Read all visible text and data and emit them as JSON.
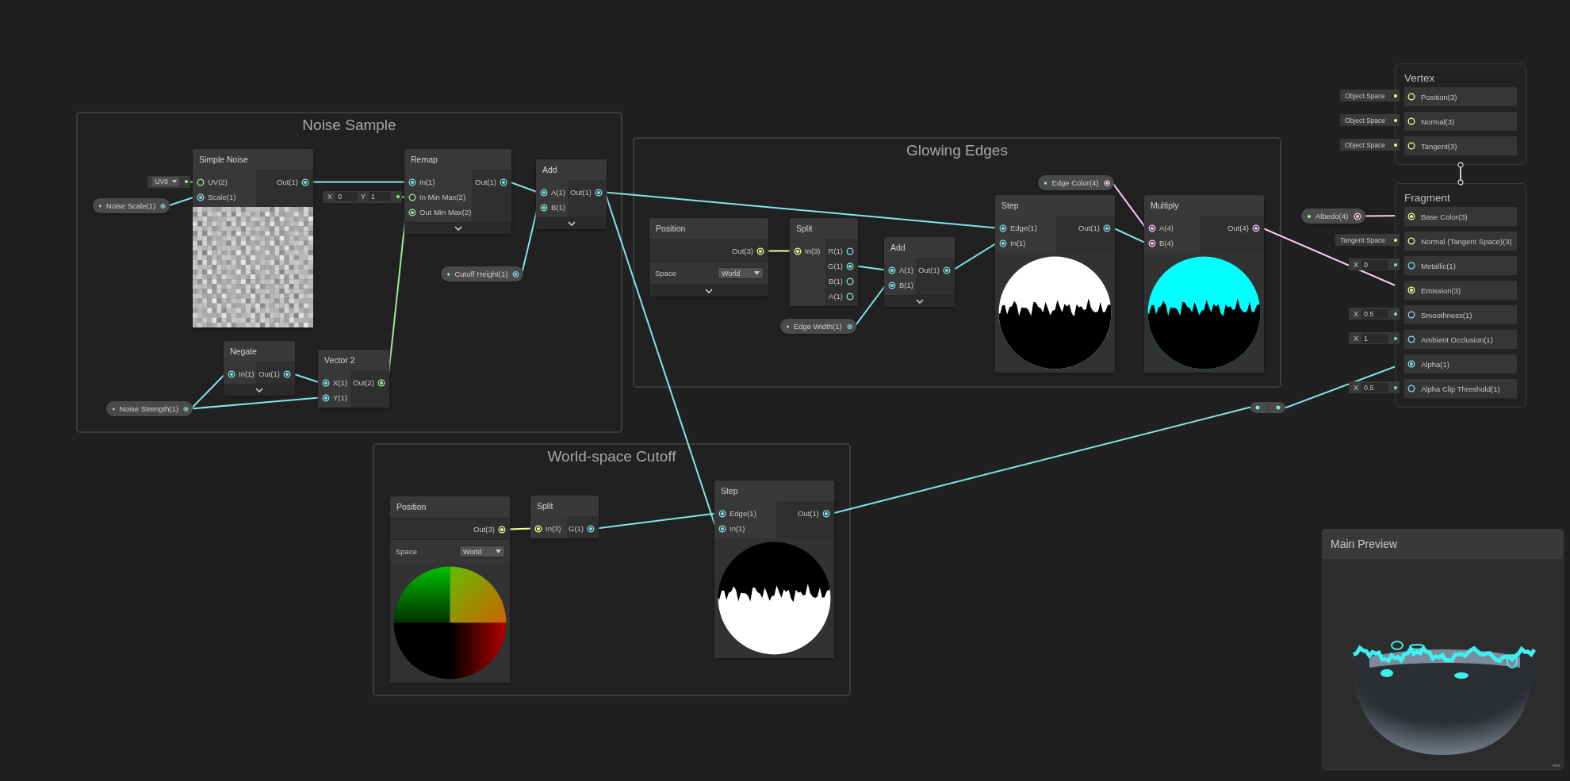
{
  "groups": [
    {
      "title": "Noise Sample"
    },
    {
      "title": "Glowing Edges"
    },
    {
      "title": "World-space Cutoff"
    }
  ],
  "nodes": [
    {
      "title": "Simple Noise",
      "kind": "noise",
      "inputs": [
        {
          "label": "UV(2)",
          "kind": "vector2",
          "connected": false,
          "default": {
            "kind": "dropdown",
            "value": "UV0"
          }
        },
        {
          "label": "Scale(1)",
          "kind": "float",
          "connected": true
        }
      ],
      "outputs": [
        {
          "label": "Out(1)",
          "kind": "float",
          "connected": true
        }
      ],
      "collapsible": false
    },
    {
      "title": "Remap",
      "kind": "plain",
      "inputs": [
        {
          "label": "In(1)",
          "kind": "float",
          "connected": true
        },
        {
          "label": "In Min Max(2)",
          "kind": "vector2",
          "connected": false,
          "default": {
            "kind": "vector",
            "fields": [
              {
                "label": "X",
                "value": "0"
              },
              {
                "label": "Y",
                "value": "1"
              }
            ]
          }
        },
        {
          "label": "Out Min Max(2)",
          "kind": "vector2",
          "connected": true
        }
      ],
      "outputs": [
        {
          "label": "Out(1)",
          "kind": "float",
          "connected": true
        }
      ],
      "collapsible": true
    },
    {
      "title": "Add",
      "kind": "plain",
      "inputs": [
        {
          "label": "A(1)",
          "kind": "float",
          "connected": true
        },
        {
          "label": "B(1)",
          "kind": "float",
          "connected": true
        }
      ],
      "outputs": [
        {
          "label": "Out(1)",
          "kind": "float",
          "connected": true
        }
      ],
      "collapsible": true
    },
    {
      "title": "Negate",
      "kind": "plain",
      "inputs": [
        {
          "label": "In(1)",
          "kind": "float",
          "connected": true
        }
      ],
      "outputs": [
        {
          "label": "Out(1)",
          "kind": "float",
          "connected": true
        }
      ],
      "collapsible": true
    },
    {
      "title": "Vector 2",
      "kind": "plain",
      "inputs": [
        {
          "label": "X(1)",
          "kind": "float",
          "connected": true
        },
        {
          "label": "Y(1)",
          "kind": "float",
          "connected": true
        }
      ],
      "outputs": [
        {
          "label": "Out(2)",
          "kind": "vector2",
          "connected": true
        }
      ],
      "collapsible": false
    },
    {
      "title": "Position",
      "kind": "plain",
      "outputs": [
        {
          "label": "Out(3)",
          "kind": "vector3",
          "connected": true
        }
      ],
      "setting": {
        "label": "Space",
        "value": "World"
      },
      "collapsible": true
    },
    {
      "title": "Split",
      "kind": "plain",
      "inputs": [
        {
          "label": "In(3)",
          "kind": "vector3",
          "connected": true
        }
      ],
      "outputs": [
        {
          "label": "R(1)",
          "kind": "float",
          "connected": false
        },
        {
          "label": "G(1)",
          "kind": "float",
          "connected": true
        },
        {
          "label": "B(1)",
          "kind": "float",
          "connected": false
        },
        {
          "label": "A(1)",
          "kind": "float",
          "connected": false
        }
      ],
      "collapsible": false
    },
    {
      "title": "Add",
      "kind": "plain",
      "inputs": [
        {
          "label": "A(1)",
          "kind": "float",
          "connected": true
        },
        {
          "label": "B(1)",
          "kind": "float",
          "connected": true
        }
      ],
      "outputs": [
        {
          "label": "Out(1)",
          "kind": "float",
          "connected": true
        }
      ],
      "collapsible": true
    },
    {
      "title": "Step",
      "kind": "mask",
      "inputs": [
        {
          "label": "Edge(1)",
          "kind": "float",
          "connected": true
        },
        {
          "label": "In(1)",
          "kind": "float",
          "connected": true
        }
      ],
      "outputs": [
        {
          "label": "Out(1)",
          "kind": "float",
          "connected": true
        }
      ],
      "collapsible": false
    },
    {
      "title": "Multiply",
      "kind": "tinted-mask",
      "inputs": [
        {
          "label": "A(4)",
          "kind": "vector4",
          "connected": true
        },
        {
          "label": "B(4)",
          "kind": "vector4",
          "connected": true
        }
      ],
      "outputs": [
        {
          "label": "Out(4)",
          "kind": "vector4",
          "connected": true
        }
      ],
      "collapsible": false
    },
    {
      "title": "Position",
      "kind": "position",
      "outputs": [
        {
          "label": "Out(3)",
          "kind": "vector3",
          "connected": true
        }
      ],
      "setting": {
        "label": "Space",
        "value": "World"
      },
      "collapsible": false
    },
    {
      "title": "Split",
      "kind": "plain",
      "inputs": [
        {
          "label": "In(3)",
          "kind": "vector3",
          "connected": true
        }
      ],
      "outputs": [
        {
          "label": "G(1)",
          "kind": "float",
          "connected": true
        }
      ],
      "collapsible": false
    },
    {
      "title": "Step",
      "kind": "inverted-mask",
      "inputs": [
        {
          "label": "Edge(1)",
          "kind": "float",
          "connected": true
        },
        {
          "label": "In(1)",
          "kind": "float",
          "connected": true
        }
      ],
      "outputs": [
        {
          "label": "Out(1)",
          "kind": "float",
          "connected": true
        }
      ],
      "collapsible": false
    }
  ],
  "properties": [
    {
      "label": "Noise Scale(1)",
      "kind": "float"
    },
    {
      "label": "Noise Strength(1)",
      "kind": "float"
    },
    {
      "label": "Cutoff Height(1)",
      "kind": "float"
    },
    {
      "label": "Edge Width(1)",
      "kind": "float"
    },
    {
      "label": "Edge Color(4)",
      "kind": "vector4"
    },
    {
      "label": "Albedo(4)",
      "kind": "vector4"
    }
  ],
  "vertex": {
    "title": "Vertex",
    "blocks": [
      {
        "label": "Position(3)",
        "kind": "vector3",
        "connected": false,
        "default": {
          "kind": "space",
          "value": "Object Space"
        }
      },
      {
        "label": "Normal(3)",
        "kind": "vector3",
        "connected": false,
        "default": {
          "kind": "space",
          "value": "Object Space"
        }
      },
      {
        "label": "Tangent(3)",
        "kind": "vector3",
        "connected": false,
        "default": {
          "kind": "space",
          "value": "Object Space"
        }
      }
    ]
  },
  "fragment": {
    "title": "Fragment",
    "blocks": [
      {
        "label": "Base Color(3)",
        "kind": "vector3",
        "connected": true
      },
      {
        "label": "Normal (Tangent Space)(3)",
        "kind": "vector3",
        "connected": false,
        "default": {
          "kind": "space",
          "value": "Tangent Space"
        }
      },
      {
        "label": "Metallic(1)",
        "kind": "float",
        "connected": false,
        "default": {
          "kind": "vector",
          "fields": [
            {
              "label": "X",
              "value": "0"
            }
          ]
        }
      },
      {
        "label": "Emission(3)",
        "kind": "vector3",
        "connected": true
      },
      {
        "label": "Smoothness(1)",
        "kind": "float",
        "connected": false,
        "default": {
          "kind": "vector",
          "fields": [
            {
              "label": "X",
              "value": "0.5"
            }
          ]
        }
      },
      {
        "label": "Ambient Occlusion(1)",
        "kind": "float",
        "connected": false,
        "default": {
          "kind": "vector",
          "fields": [
            {
              "label": "X",
              "value": "1"
            }
          ]
        }
      },
      {
        "label": "Alpha(1)",
        "kind": "float",
        "connected": true
      },
      {
        "label": "Alpha Clip Threshold(1)",
        "kind": "float",
        "connected": false,
        "default": {
          "kind": "vector",
          "fields": [
            {
              "label": "X",
              "value": "0.5"
            }
          ]
        }
      }
    ]
  },
  "main_preview": {
    "title": "Main Preview"
  }
}
